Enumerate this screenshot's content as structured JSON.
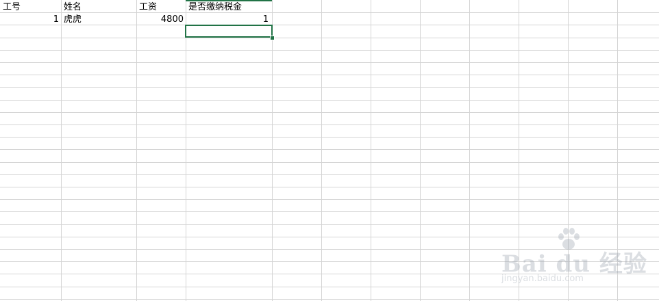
{
  "sheet": {
    "columns": [
      "工号",
      "姓名",
      "工资",
      "是否缴纳税金"
    ],
    "rows": [
      {
        "cells": [
          "1",
          "虎虎",
          "4800",
          "1"
        ]
      }
    ]
  },
  "watermark": {
    "logo_text": "Bai du 经验",
    "url": "jingyan.baidu.com"
  },
  "colors": {
    "selection": "#217346",
    "gridline": "#d4d4d4"
  }
}
